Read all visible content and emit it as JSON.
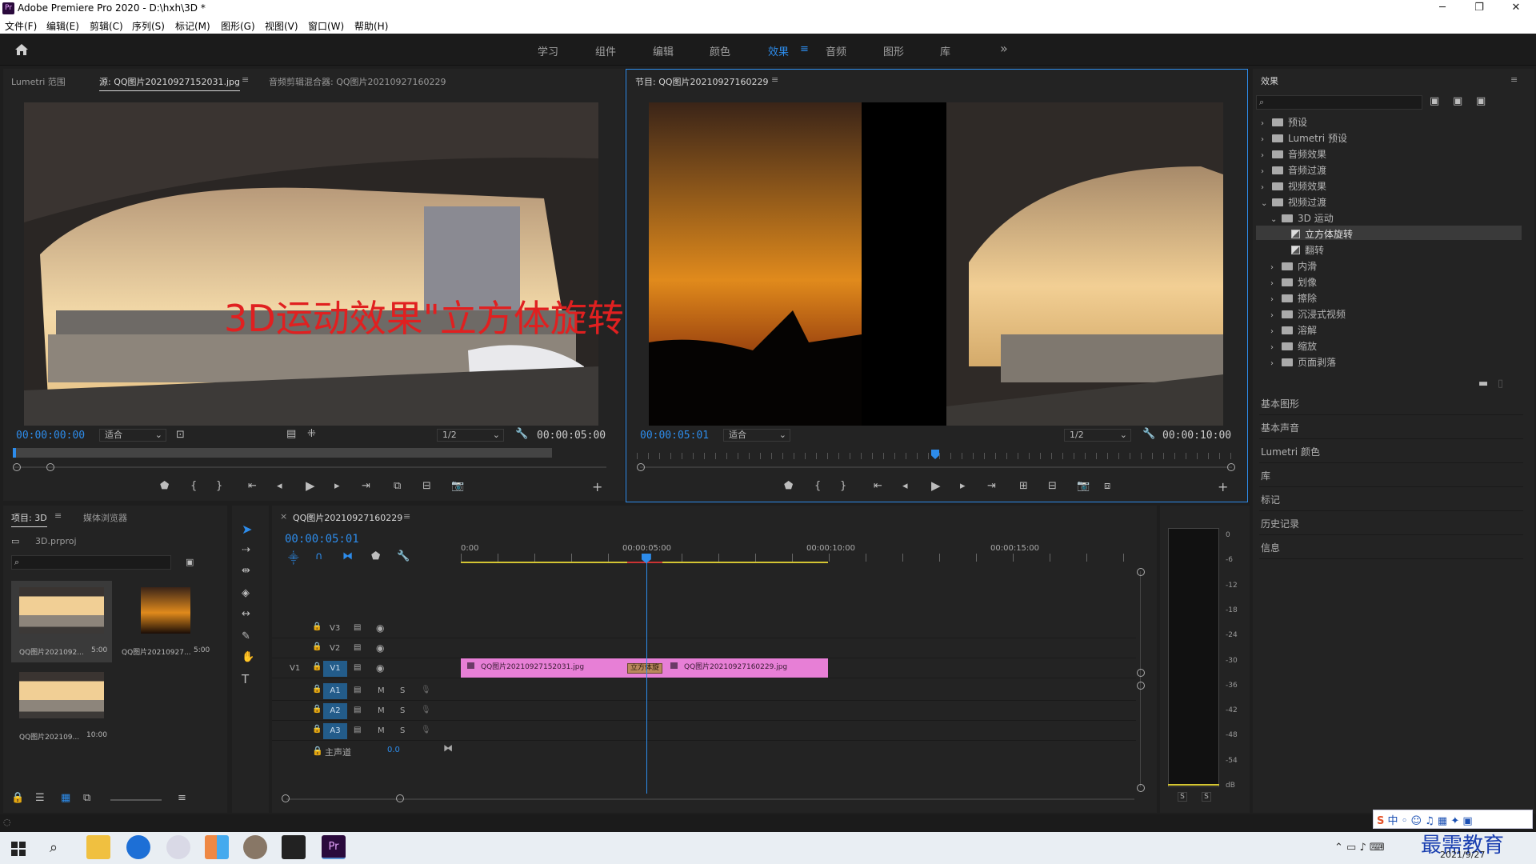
{
  "window": {
    "title": "Adobe Premiere Pro 2020 - D:\\hxh\\3D *",
    "app_icon": "Pr"
  },
  "window_controls": {
    "minimize": "─",
    "restore": "❐",
    "close": "✕"
  },
  "menu": [
    "文件(F)",
    "编辑(E)",
    "剪辑(C)",
    "序列(S)",
    "标记(M)",
    "图形(G)",
    "视图(V)",
    "窗口(W)",
    "帮助(H)"
  ],
  "workspaces": [
    "学习",
    "组件",
    "编辑",
    "颜色",
    "效果",
    "音频",
    "图形",
    "库"
  ],
  "workspace_active": "效果",
  "workspace_more": "»",
  "source": {
    "tabs": [
      "Lumetri 范围",
      "源: QQ图片20210927152031.jpg",
      "音频剪辑混合器: QQ图片20210927160229"
    ],
    "menu_icon": "≡",
    "timecode": "00:00:00:00",
    "fit": "适合",
    "resolution": "1/2",
    "duration": "00:00:05:00"
  },
  "overlay_text": "3D运动效果\"立方体旋转",
  "program": {
    "title": "节目: QQ图片20210927160229",
    "menu_icon": "≡",
    "timecode": "00:00:05:01",
    "fit": "适合",
    "resolution": "1/2",
    "duration": "00:00:10:00"
  },
  "effects": {
    "title": "效果",
    "menu_icon": "≡",
    "search_placeholder": "",
    "tree": [
      {
        "label": "预设",
        "level": 0,
        "expanded": false
      },
      {
        "label": "Lumetri 预设",
        "level": 0,
        "expanded": false
      },
      {
        "label": "音频效果",
        "level": 0,
        "expanded": false
      },
      {
        "label": "音频过渡",
        "level": 0,
        "expanded": false
      },
      {
        "label": "视频效果",
        "level": 0,
        "expanded": false
      },
      {
        "label": "视频过渡",
        "level": 0,
        "expanded": true
      },
      {
        "label": "3D 运动",
        "level": 1,
        "expanded": true
      },
      {
        "label": "立方体旋转",
        "level": 2,
        "selected": true
      },
      {
        "label": "翻转",
        "level": 2
      },
      {
        "label": "内滑",
        "level": 1,
        "expanded": false
      },
      {
        "label": "划像",
        "level": 1,
        "expanded": false
      },
      {
        "label": "擦除",
        "level": 1,
        "expanded": false
      },
      {
        "label": "沉浸式视频",
        "level": 1,
        "expanded": false
      },
      {
        "label": "溶解",
        "level": 1,
        "expanded": false
      },
      {
        "label": "缩放",
        "level": 1,
        "expanded": false
      },
      {
        "label": "页面剥落",
        "level": 1,
        "expanded": false
      }
    ],
    "side_panels": [
      "基本图形",
      "基本声音",
      "Lumetri 颜色",
      "库",
      "标记",
      "历史记录",
      "信息"
    ]
  },
  "project": {
    "tabs": [
      "项目: 3D",
      "媒体浏览器"
    ],
    "menu_icon": "≡",
    "file": "3D.prproj",
    "items": [
      {
        "name": "QQ图片2021092...",
        "dur": "5:00"
      },
      {
        "name": "QQ图片20210927...",
        "dur": "5:00"
      },
      {
        "name": "QQ图片202109...",
        "dur": "10:00"
      }
    ]
  },
  "timeline": {
    "tab": "QQ图片20210927160229",
    "close": "×",
    "menu_icon": "≡",
    "timecode": "00:00:05:01",
    "ruler": [
      "0:00",
      "00:00:05:00",
      "00:00:10:00",
      "00:00:15:00"
    ],
    "tracks": {
      "video": [
        "V3",
        "V2",
        "V1"
      ],
      "audio": [
        "A1",
        "A2",
        "A3"
      ],
      "src_v": "V1",
      "master": "主声道",
      "master_val": "0.0",
      "m": "M",
      "s": "S"
    },
    "clips": [
      {
        "name": "QQ图片20210927152031.jpg"
      },
      {
        "name": "QQ图片20210927160229.jpg"
      }
    ],
    "transition": "立方体旋",
    "playhead_seconds": 5.04
  },
  "meter": {
    "scale": [
      "0",
      "-6",
      "-12",
      "-18",
      "-24",
      "-30",
      "-36",
      "-42",
      "-48",
      "-54",
      "dB"
    ],
    "solo": [
      "S",
      "S"
    ]
  },
  "taskbar": {
    "date": "2021/9/27",
    "watermark": "最需教育",
    "ime": "中"
  }
}
